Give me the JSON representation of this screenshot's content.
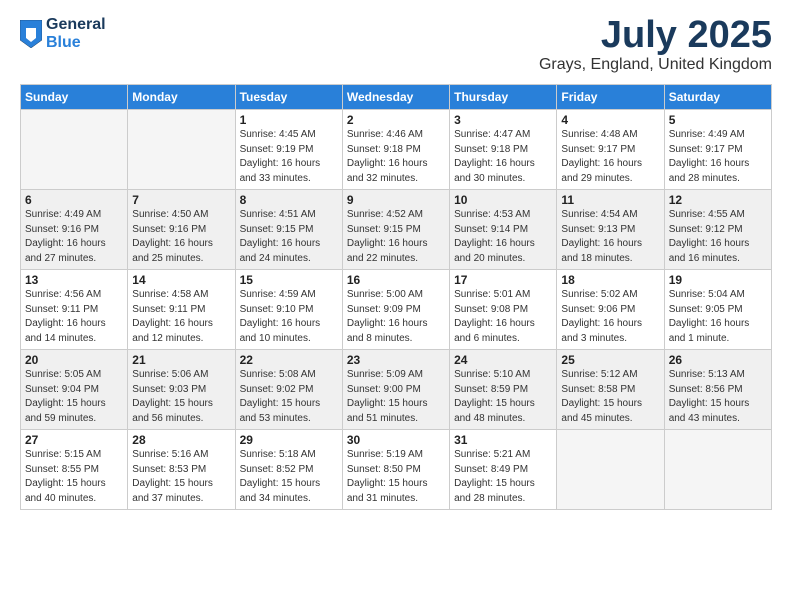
{
  "logo": {
    "general": "General",
    "blue": "Blue"
  },
  "title": "July 2025",
  "location": "Grays, England, United Kingdom",
  "weekdays": [
    "Sunday",
    "Monday",
    "Tuesday",
    "Wednesday",
    "Thursday",
    "Friday",
    "Saturday"
  ],
  "weeks": [
    [
      {
        "day": "",
        "sunrise": "",
        "sunset": "",
        "daylight": ""
      },
      {
        "day": "",
        "sunrise": "",
        "sunset": "",
        "daylight": ""
      },
      {
        "day": "1",
        "sunrise": "Sunrise: 4:45 AM",
        "sunset": "Sunset: 9:19 PM",
        "daylight": "Daylight: 16 hours and 33 minutes."
      },
      {
        "day": "2",
        "sunrise": "Sunrise: 4:46 AM",
        "sunset": "Sunset: 9:18 PM",
        "daylight": "Daylight: 16 hours and 32 minutes."
      },
      {
        "day": "3",
        "sunrise": "Sunrise: 4:47 AM",
        "sunset": "Sunset: 9:18 PM",
        "daylight": "Daylight: 16 hours and 30 minutes."
      },
      {
        "day": "4",
        "sunrise": "Sunrise: 4:48 AM",
        "sunset": "Sunset: 9:17 PM",
        "daylight": "Daylight: 16 hours and 29 minutes."
      },
      {
        "day": "5",
        "sunrise": "Sunrise: 4:49 AM",
        "sunset": "Sunset: 9:17 PM",
        "daylight": "Daylight: 16 hours and 28 minutes."
      }
    ],
    [
      {
        "day": "6",
        "sunrise": "Sunrise: 4:49 AM",
        "sunset": "Sunset: 9:16 PM",
        "daylight": "Daylight: 16 hours and 27 minutes."
      },
      {
        "day": "7",
        "sunrise": "Sunrise: 4:50 AM",
        "sunset": "Sunset: 9:16 PM",
        "daylight": "Daylight: 16 hours and 25 minutes."
      },
      {
        "day": "8",
        "sunrise": "Sunrise: 4:51 AM",
        "sunset": "Sunset: 9:15 PM",
        "daylight": "Daylight: 16 hours and 24 minutes."
      },
      {
        "day": "9",
        "sunrise": "Sunrise: 4:52 AM",
        "sunset": "Sunset: 9:15 PM",
        "daylight": "Daylight: 16 hours and 22 minutes."
      },
      {
        "day": "10",
        "sunrise": "Sunrise: 4:53 AM",
        "sunset": "Sunset: 9:14 PM",
        "daylight": "Daylight: 16 hours and 20 minutes."
      },
      {
        "day": "11",
        "sunrise": "Sunrise: 4:54 AM",
        "sunset": "Sunset: 9:13 PM",
        "daylight": "Daylight: 16 hours and 18 minutes."
      },
      {
        "day": "12",
        "sunrise": "Sunrise: 4:55 AM",
        "sunset": "Sunset: 9:12 PM",
        "daylight": "Daylight: 16 hours and 16 minutes."
      }
    ],
    [
      {
        "day": "13",
        "sunrise": "Sunrise: 4:56 AM",
        "sunset": "Sunset: 9:11 PM",
        "daylight": "Daylight: 16 hours and 14 minutes."
      },
      {
        "day": "14",
        "sunrise": "Sunrise: 4:58 AM",
        "sunset": "Sunset: 9:11 PM",
        "daylight": "Daylight: 16 hours and 12 minutes."
      },
      {
        "day": "15",
        "sunrise": "Sunrise: 4:59 AM",
        "sunset": "Sunset: 9:10 PM",
        "daylight": "Daylight: 16 hours and 10 minutes."
      },
      {
        "day": "16",
        "sunrise": "Sunrise: 5:00 AM",
        "sunset": "Sunset: 9:09 PM",
        "daylight": "Daylight: 16 hours and 8 minutes."
      },
      {
        "day": "17",
        "sunrise": "Sunrise: 5:01 AM",
        "sunset": "Sunset: 9:08 PM",
        "daylight": "Daylight: 16 hours and 6 minutes."
      },
      {
        "day": "18",
        "sunrise": "Sunrise: 5:02 AM",
        "sunset": "Sunset: 9:06 PM",
        "daylight": "Daylight: 16 hours and 3 minutes."
      },
      {
        "day": "19",
        "sunrise": "Sunrise: 5:04 AM",
        "sunset": "Sunset: 9:05 PM",
        "daylight": "Daylight: 16 hours and 1 minute."
      }
    ],
    [
      {
        "day": "20",
        "sunrise": "Sunrise: 5:05 AM",
        "sunset": "Sunset: 9:04 PM",
        "daylight": "Daylight: 15 hours and 59 minutes."
      },
      {
        "day": "21",
        "sunrise": "Sunrise: 5:06 AM",
        "sunset": "Sunset: 9:03 PM",
        "daylight": "Daylight: 15 hours and 56 minutes."
      },
      {
        "day": "22",
        "sunrise": "Sunrise: 5:08 AM",
        "sunset": "Sunset: 9:02 PM",
        "daylight": "Daylight: 15 hours and 53 minutes."
      },
      {
        "day": "23",
        "sunrise": "Sunrise: 5:09 AM",
        "sunset": "Sunset: 9:00 PM",
        "daylight": "Daylight: 15 hours and 51 minutes."
      },
      {
        "day": "24",
        "sunrise": "Sunrise: 5:10 AM",
        "sunset": "Sunset: 8:59 PM",
        "daylight": "Daylight: 15 hours and 48 minutes."
      },
      {
        "day": "25",
        "sunrise": "Sunrise: 5:12 AM",
        "sunset": "Sunset: 8:58 PM",
        "daylight": "Daylight: 15 hours and 45 minutes."
      },
      {
        "day": "26",
        "sunrise": "Sunrise: 5:13 AM",
        "sunset": "Sunset: 8:56 PM",
        "daylight": "Daylight: 15 hours and 43 minutes."
      }
    ],
    [
      {
        "day": "27",
        "sunrise": "Sunrise: 5:15 AM",
        "sunset": "Sunset: 8:55 PM",
        "daylight": "Daylight: 15 hours and 40 minutes."
      },
      {
        "day": "28",
        "sunrise": "Sunrise: 5:16 AM",
        "sunset": "Sunset: 8:53 PM",
        "daylight": "Daylight: 15 hours and 37 minutes."
      },
      {
        "day": "29",
        "sunrise": "Sunrise: 5:18 AM",
        "sunset": "Sunset: 8:52 PM",
        "daylight": "Daylight: 15 hours and 34 minutes."
      },
      {
        "day": "30",
        "sunrise": "Sunrise: 5:19 AM",
        "sunset": "Sunset: 8:50 PM",
        "daylight": "Daylight: 15 hours and 31 minutes."
      },
      {
        "day": "31",
        "sunrise": "Sunrise: 5:21 AM",
        "sunset": "Sunset: 8:49 PM",
        "daylight": "Daylight: 15 hours and 28 minutes."
      },
      {
        "day": "",
        "sunrise": "",
        "sunset": "",
        "daylight": ""
      },
      {
        "day": "",
        "sunrise": "",
        "sunset": "",
        "daylight": ""
      }
    ]
  ]
}
